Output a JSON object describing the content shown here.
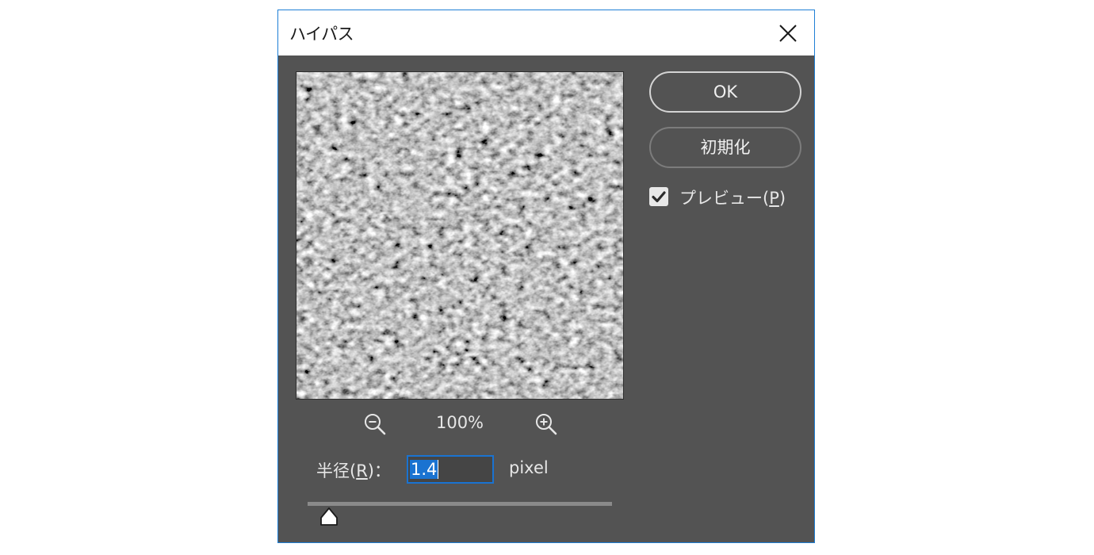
{
  "window": {
    "title": "ハイパス",
    "close_icon": "close-icon"
  },
  "preview": {
    "image": "high-pass-filtered-texture",
    "zoom_level": "100%",
    "zoom_out_icon": "zoom-out-icon",
    "zoom_in_icon": "zoom-in-icon"
  },
  "radius": {
    "label_prefix": "半径(",
    "label_mnemonic": "R",
    "label_suffix": ")：",
    "value": "1.4",
    "unit": "pixel",
    "slider_fraction": 0.07
  },
  "buttons": {
    "ok_label": "OK",
    "reset_label": "初期化"
  },
  "preview_option": {
    "label_prefix": "プレビュー(",
    "label_mnemonic": "P",
    "label_suffix": ")",
    "checked": true
  },
  "colors": {
    "dialog_bg": "#535353",
    "accent_border": "#1e7fd6",
    "selection": "#1a73d1",
    "text": "#e6e6e6"
  }
}
